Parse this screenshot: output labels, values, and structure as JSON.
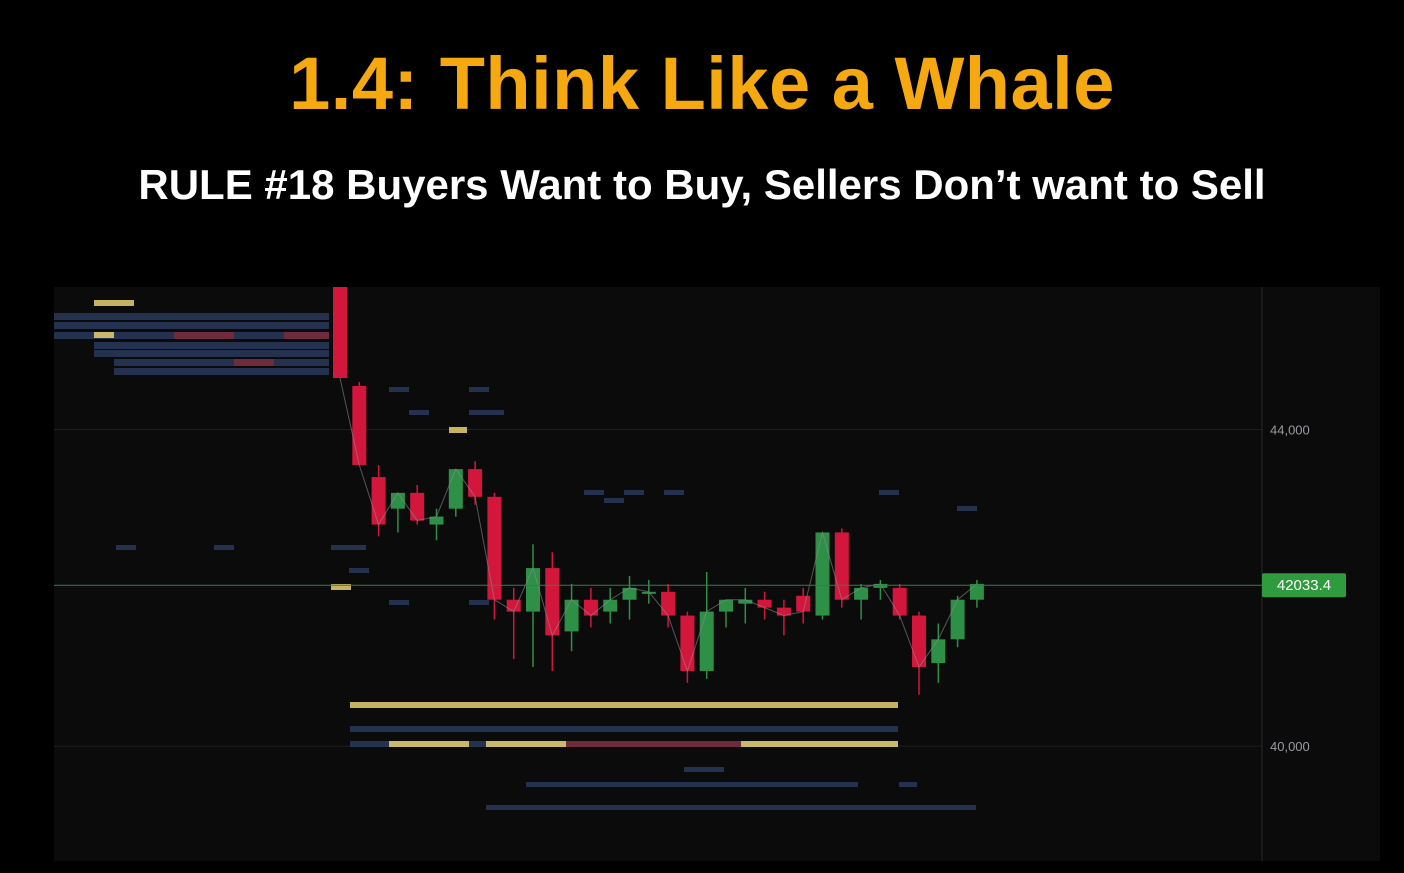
{
  "slide": {
    "title": "1.4: Think Like a Whale",
    "subtitle": "RULE #18 Buyers Want to Buy, Sellers Don’t want to Sell"
  },
  "colors": {
    "title": "#f5a80f",
    "up_candle": "#2e8f47",
    "down_candle": "#d3173c",
    "current_price_line": "#3c7a45",
    "current_price_badge": "#2f9a3e",
    "heat_yellow": "#e8d070",
    "heat_blue": "#2a3a5c",
    "heat_red": "#7a2a3a"
  },
  "chart_data": {
    "type": "candlestick",
    "y_axis_ticks": [
      {
        "value": 44000,
        "label": "44,000"
      },
      {
        "value": 40000,
        "label": "40,000"
      }
    ],
    "ylim": [
      38550,
      45800
    ],
    "current_price": {
      "value": 42033.4,
      "label": "42033.4"
    },
    "grid": true,
    "candles": [
      {
        "o": 45800,
        "h": 45900,
        "l": 44700,
        "c": 44650
      },
      {
        "o": 44550,
        "h": 44600,
        "l": 43700,
        "c": 43550
      },
      {
        "o": 43400,
        "h": 43550,
        "l": 42650,
        "c": 42800
      },
      {
        "o": 43000,
        "h": 43150,
        "l": 42700,
        "c": 43200
      },
      {
        "o": 43200,
        "h": 43300,
        "l": 42800,
        "c": 42850
      },
      {
        "o": 42800,
        "h": 43000,
        "l": 42600,
        "c": 42900
      },
      {
        "o": 43000,
        "h": 43400,
        "l": 42900,
        "c": 43500
      },
      {
        "o": 43500,
        "h": 43600,
        "l": 43050,
        "c": 43150
      },
      {
        "o": 43150,
        "h": 43200,
        "l": 41600,
        "c": 41850
      },
      {
        "o": 41850,
        "h": 42000,
        "l": 41100,
        "c": 41700
      },
      {
        "o": 41700,
        "h": 42550,
        "l": 41000,
        "c": 42250
      },
      {
        "o": 42250,
        "h": 42450,
        "l": 40950,
        "c": 41400
      },
      {
        "o": 41450,
        "h": 42050,
        "l": 41200,
        "c": 41850
      },
      {
        "o": 41850,
        "h": 42000,
        "l": 41500,
        "c": 41650
      },
      {
        "o": 41700,
        "h": 42000,
        "l": 41550,
        "c": 41850
      },
      {
        "o": 41850,
        "h": 42150,
        "l": 41600,
        "c": 42000
      },
      {
        "o": 41950,
        "h": 42100,
        "l": 41800,
        "c": 41950
      },
      {
        "o": 41950,
        "h": 42050,
        "l": 41500,
        "c": 41650
      },
      {
        "o": 41650,
        "h": 41700,
        "l": 40800,
        "c": 40950
      },
      {
        "o": 40950,
        "h": 42200,
        "l": 40850,
        "c": 41700
      },
      {
        "o": 41700,
        "h": 41850,
        "l": 41500,
        "c": 41850
      },
      {
        "o": 41800,
        "h": 42000,
        "l": 41550,
        "c": 41850
      },
      {
        "o": 41850,
        "h": 41950,
        "l": 41600,
        "c": 41750
      },
      {
        "o": 41750,
        "h": 41850,
        "l": 41400,
        "c": 41650
      },
      {
        "o": 41900,
        "h": 42000,
        "l": 41550,
        "c": 41700
      },
      {
        "o": 41650,
        "h": 42700,
        "l": 41600,
        "c": 42700
      },
      {
        "o": 42700,
        "h": 42750,
        "l": 41750,
        "c": 41850
      },
      {
        "o": 41850,
        "h": 42050,
        "l": 41600,
        "c": 42000
      },
      {
        "o": 42000,
        "h": 42100,
        "l": 41850,
        "c": 42050
      },
      {
        "o": 42000,
        "h": 42050,
        "l": 41600,
        "c": 41650
      },
      {
        "o": 41650,
        "h": 41700,
        "l": 40650,
        "c": 41000
      },
      {
        "o": 41050,
        "h": 41550,
        "l": 40800,
        "c": 41350
      },
      {
        "o": 41350,
        "h": 41900,
        "l": 41250,
        "c": 41850
      },
      {
        "o": 41850,
        "h": 42100,
        "l": 41750,
        "c": 42050
      }
    ]
  }
}
